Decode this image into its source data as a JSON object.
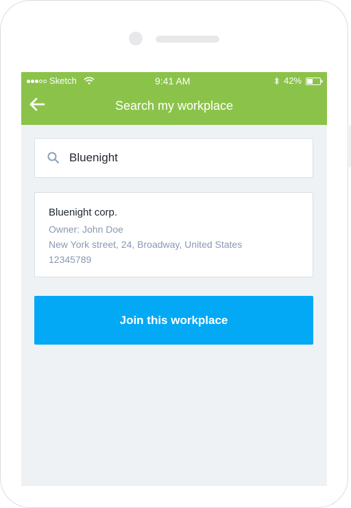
{
  "status_bar": {
    "carrier": "Sketch",
    "time": "9:41 AM",
    "battery": "42%",
    "icons": [
      "signal-icon",
      "wifi-icon",
      "bluetooth-icon",
      "battery-icon"
    ]
  },
  "header": {
    "title": "Search my workplace",
    "back_icon": "arrow-left-icon",
    "color": "#8bc34a"
  },
  "search": {
    "value": "Bluenight",
    "placeholder": "",
    "icon": "search-icon"
  },
  "result": {
    "name": "Bluenight corp.",
    "owner": "Owner: John Doe",
    "address": "New York street, 24, Broadway, United States",
    "code": "12345789"
  },
  "action": {
    "join_label": "Join this workplace",
    "color": "#03a9f4"
  }
}
